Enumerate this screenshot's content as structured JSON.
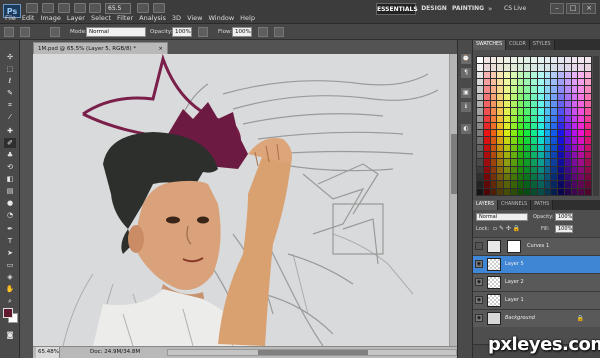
{
  "app": {
    "logo": "Ps",
    "zoom": "65.5",
    "workspaces": [
      "ESSENTIALS",
      "DESIGN",
      "PAINTING"
    ],
    "more": "»",
    "cs_live": "CS Live"
  },
  "menu": [
    "File",
    "Edit",
    "Image",
    "Layer",
    "Select",
    "Filter",
    "Analysis",
    "3D",
    "View",
    "Window",
    "Help"
  ],
  "options": {
    "mode_label": "Mode:",
    "mode_value": "Normal",
    "opacity_label": "Opacity:",
    "opacity_value": "100%",
    "flow_label": "Flow:",
    "flow_value": "100%"
  },
  "document": {
    "tab_title": "1M.psd @ 65.5% (Layer 5, RGB/8) *",
    "tab_close": "×",
    "zoom_status": "65.48%",
    "doc_status": "Doc: 24.9M/34.8M"
  },
  "swatches_panel": {
    "tabs": [
      "SWATCHES",
      "COLOR",
      "STYLES"
    ],
    "active": "SWATCHES"
  },
  "layers_panel": {
    "tabs": [
      "LAYERS",
      "CHANNELS",
      "PATHS"
    ],
    "active": "LAYERS",
    "blend_mode": "Normal",
    "opacity_label": "Opacity:",
    "opacity_value": "100%",
    "lock_label": "Lock:",
    "fill_label": "Fill:",
    "fill_value": "100%",
    "layers": [
      {
        "name": "Curves 1",
        "visible": false,
        "selected": false
      },
      {
        "name": "Layer 5",
        "visible": true,
        "selected": true
      },
      {
        "name": "Layer 2",
        "visible": true,
        "selected": false
      },
      {
        "name": "Layer 1",
        "visible": true,
        "selected": false
      },
      {
        "name": "Background",
        "visible": true,
        "selected": false
      }
    ]
  },
  "colors": {
    "foreground": "#5f1a2d",
    "background": "#ffffff",
    "selected_layer": "#3f86d4"
  },
  "watermark": "pxleyes.com"
}
